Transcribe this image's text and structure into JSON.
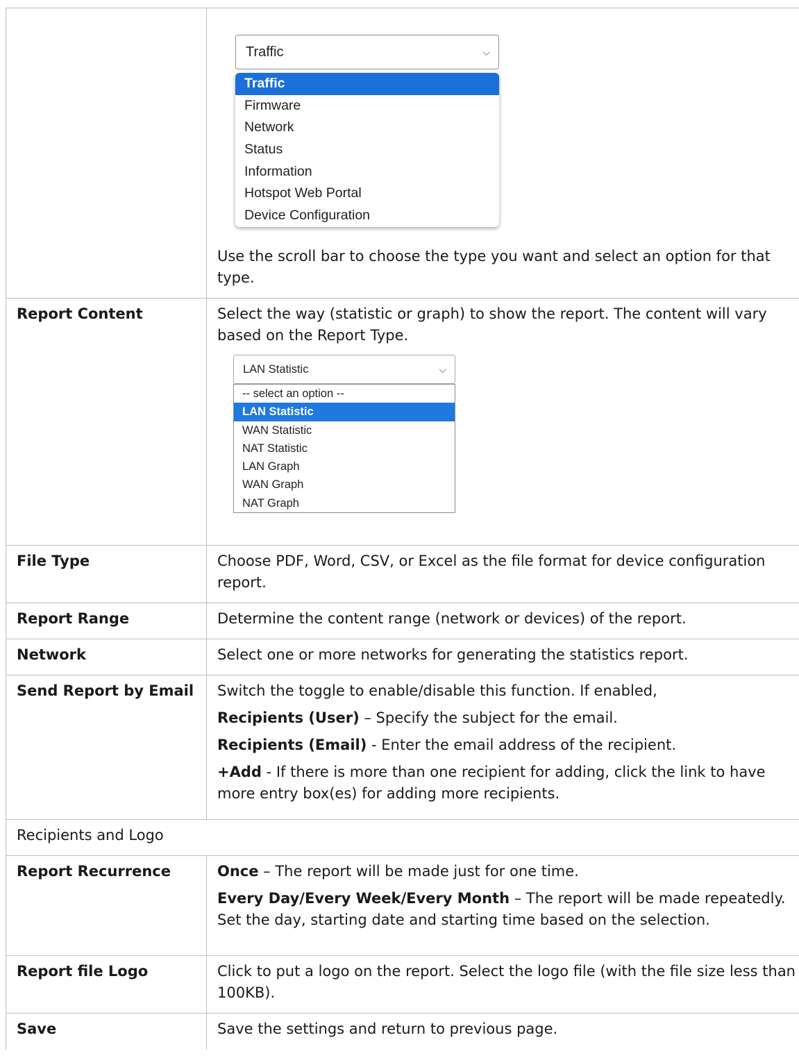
{
  "report_type_dropdown": {
    "selected": "Traffic",
    "options": [
      "Traffic",
      "Firmware",
      "Network",
      "Status",
      "Information",
      "Hotspot Web Portal",
      "Device Configuration"
    ],
    "selected_index": 0
  },
  "report_type_note": "Use the scroll bar to choose the type you want and select an option for that type.",
  "report_content": {
    "label": "Report Content",
    "desc": "Select the way (statistic or graph) to show the report. The content will vary based on the Report Type.",
    "dropdown": {
      "selected": "LAN Statistic",
      "options": [
        "-- select an option --",
        "LAN Statistic",
        "WAN Statistic",
        "NAT Statistic",
        "LAN Graph",
        "WAN Graph",
        "NAT Graph"
      ],
      "selected_index": 1
    }
  },
  "file_type": {
    "label": "File Type",
    "desc": "Choose PDF, Word, CSV, or Excel as the file format for device configuration report."
  },
  "report_range": {
    "label": "Report Range",
    "desc": "Determine the content range (network or devices) of the report."
  },
  "network": {
    "label": "Network",
    "desc": "Select one or more networks for generating the statistics report."
  },
  "send_email": {
    "label": "Send Report by Email",
    "line1": "Switch the toggle to enable/disable this function. If enabled,",
    "r_user_kw": "Recipients (User)",
    "r_user_text": " – Specify the subject for the email.",
    "r_email_kw": "Recipients (Email)",
    "r_email_text": " - Enter the email address of the recipient.",
    "add_kw": "+Add",
    "add_text": " - If there is more than one recipient for adding, click the link to have more entry box(es) for adding more recipients."
  },
  "section_header": "Recipients and Logo",
  "recurrence": {
    "label": "Report Recurrence",
    "once_kw": "Once",
    "once_text": " – The report will be made just for one time.",
    "every_kw": "Every Day/Every Week/Every Month",
    "every_text": " – The report will be made repeatedly. Set the day, starting date and starting time based on the selection."
  },
  "logo": {
    "label": "Report file Logo",
    "desc": "Click to put a logo on the report. Select the logo file (with the file size less than 100KB)."
  },
  "save": {
    "label": "Save",
    "desc": "Save the settings and return to previous page."
  }
}
